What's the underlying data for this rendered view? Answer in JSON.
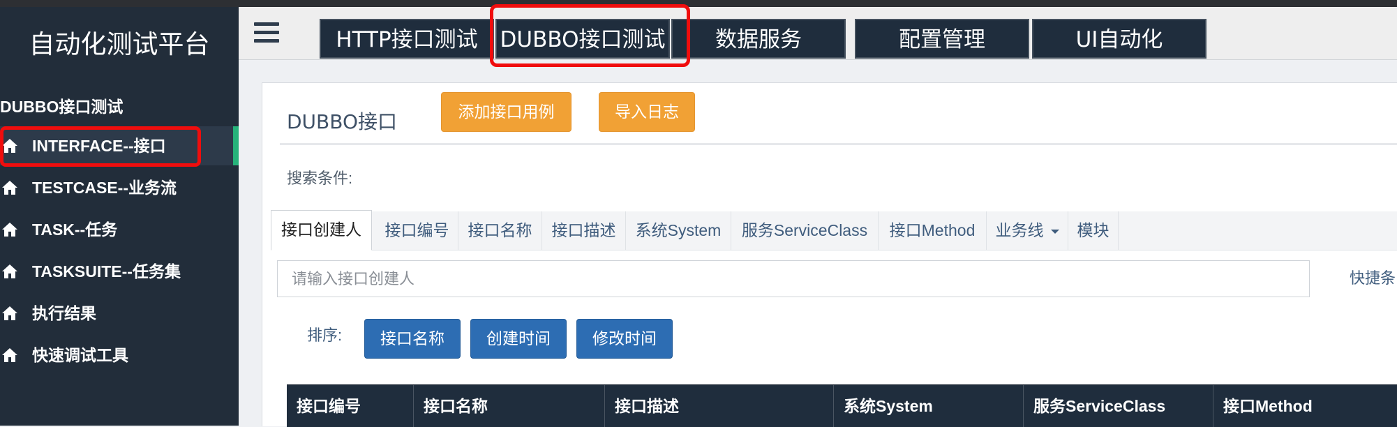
{
  "app": {
    "title": "自动化测试平台"
  },
  "sidebar": {
    "section_title": "DUBBO接口测试",
    "items": [
      {
        "label": "INTERFACE--接口",
        "icon": "home-icon",
        "active": true
      },
      {
        "label": "TESTCASE--业务流",
        "icon": "home-icon"
      },
      {
        "label": "TASK--任务",
        "icon": "home-icon"
      },
      {
        "label": "TASKSUITE--任务集",
        "icon": "home-icon"
      },
      {
        "label": "执行结果",
        "icon": "home-icon"
      },
      {
        "label": "快速调试工具",
        "icon": "home-icon"
      }
    ]
  },
  "navbar": {
    "menu_icon": "hamburger-icon",
    "tabs": [
      {
        "label": "HTTP接口测试"
      },
      {
        "label": "DUBBO接口测试",
        "active": true
      },
      {
        "label": "数据服务"
      },
      {
        "label": "配置管理"
      },
      {
        "label": "UI自动化"
      }
    ]
  },
  "main": {
    "title": "DUBBO接口",
    "buttons": {
      "add_case": "添加接口用例",
      "import_log": "导入日志"
    },
    "search_label": "搜索条件:",
    "filter_tabs": [
      {
        "label": "接口创建人",
        "active": true
      },
      {
        "label": "接口编号"
      },
      {
        "label": "接口名称"
      },
      {
        "label": "接口描述"
      },
      {
        "label": "系统System"
      },
      {
        "label": "服务ServiceClass"
      },
      {
        "label": "接口Method"
      },
      {
        "label": "业务线",
        "dropdown": true
      },
      {
        "label": "模块"
      }
    ],
    "search_input": {
      "placeholder": "请输入接口创建人",
      "value": ""
    },
    "shortcut_label": "快捷条",
    "sort": {
      "label": "排序:",
      "buttons": [
        "接口名称",
        "创建时间",
        "修改时间"
      ]
    },
    "table": {
      "columns": [
        "接口编号",
        "接口名称",
        "接口描述",
        "系统System",
        "服务ServiceClass",
        "接口Method"
      ]
    }
  },
  "colors": {
    "sidebar_bg": "#222d3a",
    "nav_tab_bg": "#1f2d3d",
    "accent_green": "#26b37a",
    "orange_button": "#f1a135",
    "blue_button": "#2d6db3",
    "highlight_red": "#f00d0d"
  }
}
